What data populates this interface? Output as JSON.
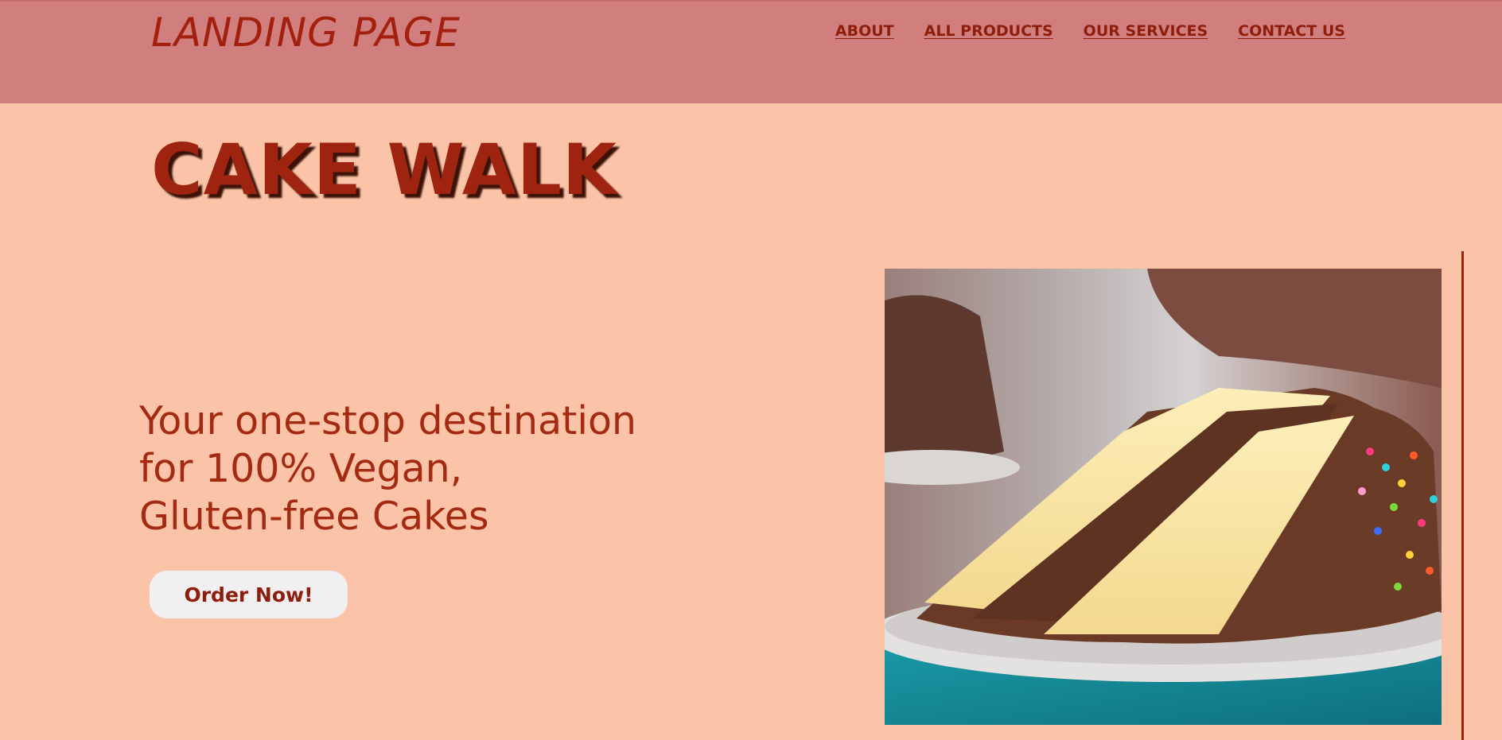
{
  "header": {
    "brand": "LANDING PAGE",
    "nav": [
      "ABOUT",
      "ALL PRODUCTS",
      "OUR SERVICES",
      "CONTACT US"
    ]
  },
  "hero": {
    "title": "CAKE WALK",
    "tagline_lines": [
      "Your one-stop destination",
      "for 100% Vegan,",
      "Gluten-free Cakes"
    ],
    "cta_label": "Order Now!"
  },
  "image": {
    "icon": "cake-slice-photo",
    "subject": "chocolate-frosted vanilla layer cake slice"
  },
  "colors": {
    "page_bg": "#fbc4a8",
    "header_bg": "#d17e7e",
    "text": "#9a2210",
    "button_bg": "#f1eff0"
  }
}
